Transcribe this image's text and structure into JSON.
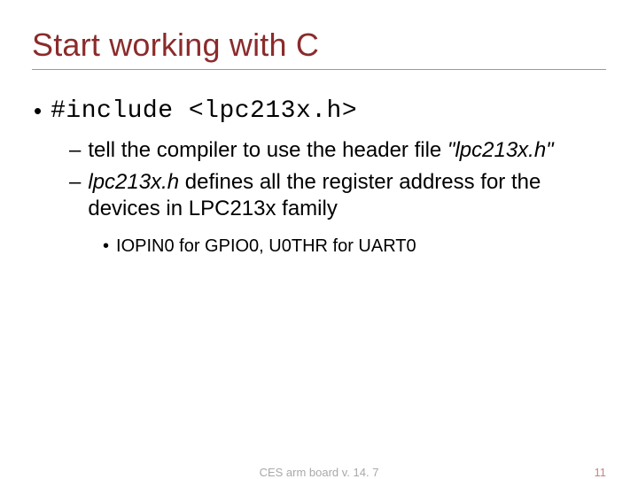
{
  "title": "Start working with C",
  "bullets": {
    "lvl1": "#include <lpc213x.h>",
    "lvl2a_pre": "tell the compiler to use the header file ",
    "lvl2a_file": "\"lpc213x.h\"",
    "lvl2b_file": "lpc213x.h",
    "lvl2b_rest": " defines all the register address for the devices in LPC213x family",
    "lvl3": "IOPIN0 for GPIO0, U0THR for UART0"
  },
  "footer": {
    "center": "CES arm board v. 14. 7",
    "page": "11"
  }
}
